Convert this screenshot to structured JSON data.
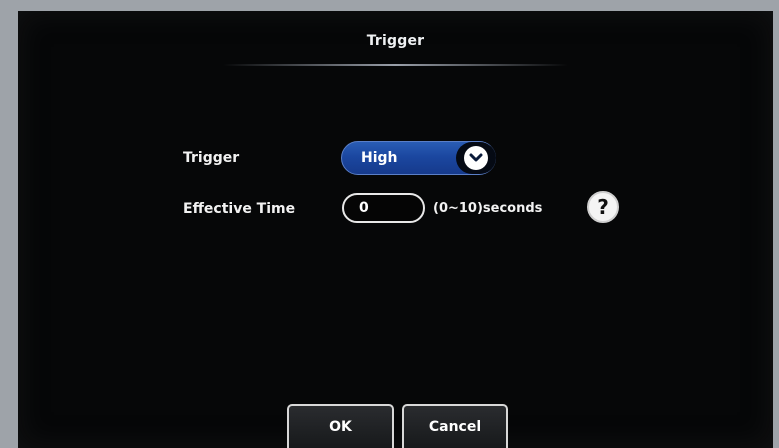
{
  "dialog": {
    "title": "Trigger"
  },
  "form": {
    "trigger_label": "Trigger",
    "trigger_value": "High",
    "effective_time_label": "Effective Time",
    "effective_time_value": "0",
    "effective_time_range": "(0~10)seconds",
    "help_glyph": "?"
  },
  "buttons": {
    "ok_label": "OK",
    "cancel_label": "Cancel"
  },
  "icons": {
    "dropdown": "chevron-down-icon",
    "help": "question-mark-icon"
  },
  "colors": {
    "select_accent": "#1b47a0",
    "background": "#060708",
    "frame": "#9ea3a9"
  }
}
